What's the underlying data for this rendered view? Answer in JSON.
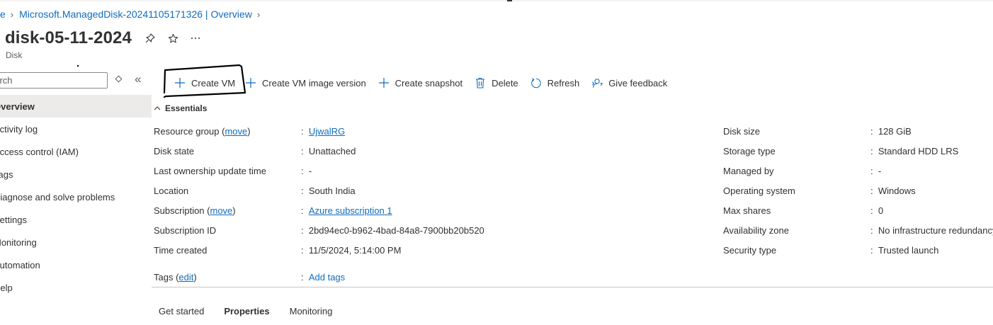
{
  "breadcrumb": {
    "home_fragment": "e",
    "deployment": "Microsoft.ManagedDisk-20241105171326 | Overview"
  },
  "resource": {
    "title": "disk-05-11-2024",
    "type": "Disk"
  },
  "sidebar": {
    "search_placeholder": "earch",
    "items": [
      {
        "label": "Overview",
        "active": true
      },
      {
        "label": "Activity log"
      },
      {
        "label": "Access control (IAM)"
      },
      {
        "label": "Tags"
      },
      {
        "label": "Diagnose and solve problems"
      },
      {
        "label": "Settings"
      },
      {
        "label": "Monitoring"
      },
      {
        "label": "Automation"
      },
      {
        "label": "Help"
      }
    ]
  },
  "toolbar": {
    "create_vm": "Create VM",
    "create_vm_image_version": "Create VM image version",
    "create_snapshot": "Create snapshot",
    "delete": "Delete",
    "refresh": "Refresh",
    "give_feedback": "Give feedback"
  },
  "essentials": {
    "heading": "Essentials",
    "left": {
      "resource_group": {
        "label": "Resource group (",
        "move": "move",
        "close": ")",
        "value": "UjwalRG"
      },
      "disk_state": {
        "label": "Disk state",
        "value": "Unattached"
      },
      "last_ownership": {
        "label": "Last ownership update time",
        "value": "-"
      },
      "location": {
        "label": "Location",
        "value": "South India"
      },
      "subscription": {
        "label": "Subscription (",
        "move": "move",
        "close": ")",
        "value": "Azure subscription 1"
      },
      "subscription_id": {
        "label": "Subscription ID",
        "value": "2bd94ec0-b962-4bad-84a8-7900bb20b520"
      },
      "time_created": {
        "label": "Time created",
        "value": "11/5/2024, 5:14:00 PM"
      }
    },
    "right": {
      "disk_size": {
        "label": "Disk size",
        "value": "128 GiB"
      },
      "storage_type": {
        "label": "Storage type",
        "value": "Standard HDD LRS"
      },
      "managed_by": {
        "label": "Managed by",
        "value": "-"
      },
      "operating_system": {
        "label": "Operating system",
        "value": "Windows"
      },
      "max_shares": {
        "label": "Max shares",
        "value": "0"
      },
      "availability_zone": {
        "label": "Availability zone",
        "value": "No infrastructure redundancy"
      },
      "security_type": {
        "label": "Security type",
        "value": "Trusted launch"
      }
    },
    "tags": {
      "label": "Tags (",
      "edit": "edit",
      "close": ")",
      "value": "Add tags"
    }
  },
  "tabs": [
    {
      "label": "Get started"
    },
    {
      "label": "Properties",
      "active": true
    },
    {
      "label": "Monitoring"
    }
  ],
  "colors": {
    "link": "#0f6cbd",
    "text": "#323130",
    "active_bg": "#edebe9"
  }
}
